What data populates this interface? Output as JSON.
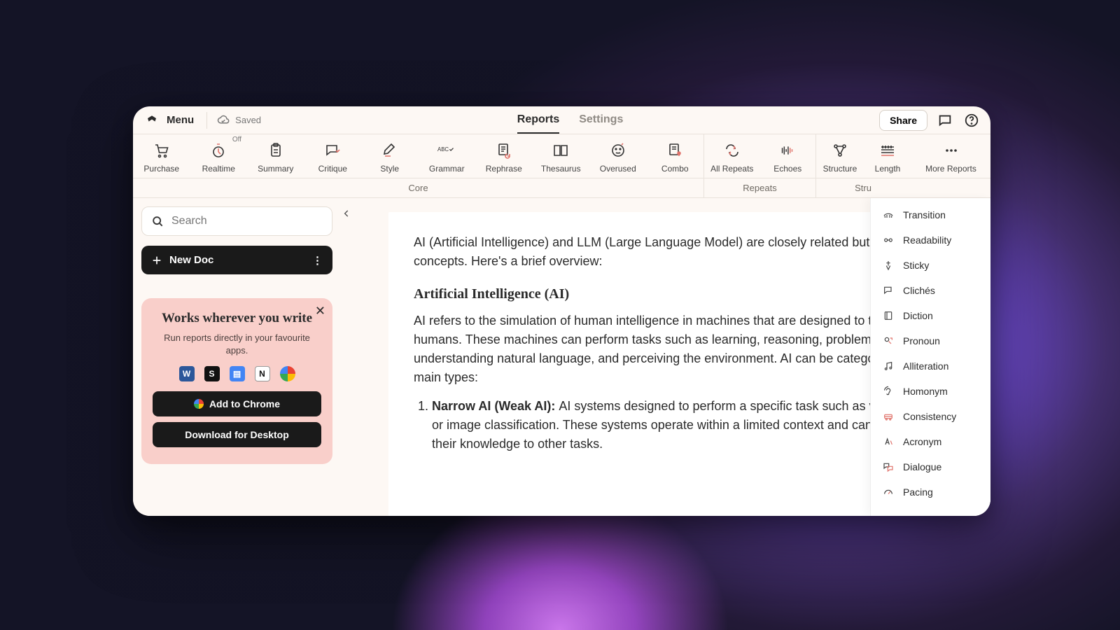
{
  "topbar": {
    "menu": "Menu",
    "saved": "Saved",
    "tab_reports": "Reports",
    "tab_settings": "Settings",
    "share": "Share"
  },
  "toolbar": {
    "items": [
      {
        "label": "Purchase"
      },
      {
        "label": "Realtime",
        "badge": "Off"
      },
      {
        "label": "Summary"
      },
      {
        "label": "Critique"
      },
      {
        "label": "Style"
      },
      {
        "label": "Grammar"
      },
      {
        "label": "Rephrase"
      },
      {
        "label": "Thesaurus"
      },
      {
        "label": "Overused"
      },
      {
        "label": "Combo"
      },
      {
        "label": "All Repeats"
      },
      {
        "label": "Echoes"
      },
      {
        "label": "Structure"
      },
      {
        "label": "Length"
      },
      {
        "label": "More Reports"
      }
    ],
    "group_core": "Core",
    "group_repeats": "Repeats",
    "group_structure": "Stru"
  },
  "sidebar": {
    "search_placeholder": "Search",
    "new_doc": "New Doc",
    "promo": {
      "title": "Works wherever you write",
      "subtitle": "Run reports directly in your favourite apps.",
      "btn_chrome": "Add to Chrome",
      "btn_desktop": "Download for Desktop"
    }
  },
  "editor": {
    "p1": "AI (Artificial Intelligence) and LLM (Large Language Model) are closely related but distinct concepts. Here's a brief overview:",
    "h1": "Artificial Intelligence (AI)",
    "p2": "AI refers to the simulation of human intelligence in machines that are designed to think and act like humans. These machines can perform tasks such as learning, reasoning, problem-solving, understanding natural language, and perceiving the environment. AI can be categorized into two main types:",
    "li1_bold": "Narrow AI (Weak AI): ",
    "li1_rest": "AI systems designed to perform a specific task such as voice recognition or image classification. These systems operate within a limited context and cannot generalize their knowledge to other tasks."
  },
  "dropdown": {
    "items": [
      "Transition",
      "Readability",
      "Sticky",
      "Clichés",
      "Diction",
      "Pronoun",
      "Alliteration",
      "Homonym",
      "Consistency",
      "Acronym",
      "Dialogue",
      "Pacing"
    ]
  }
}
